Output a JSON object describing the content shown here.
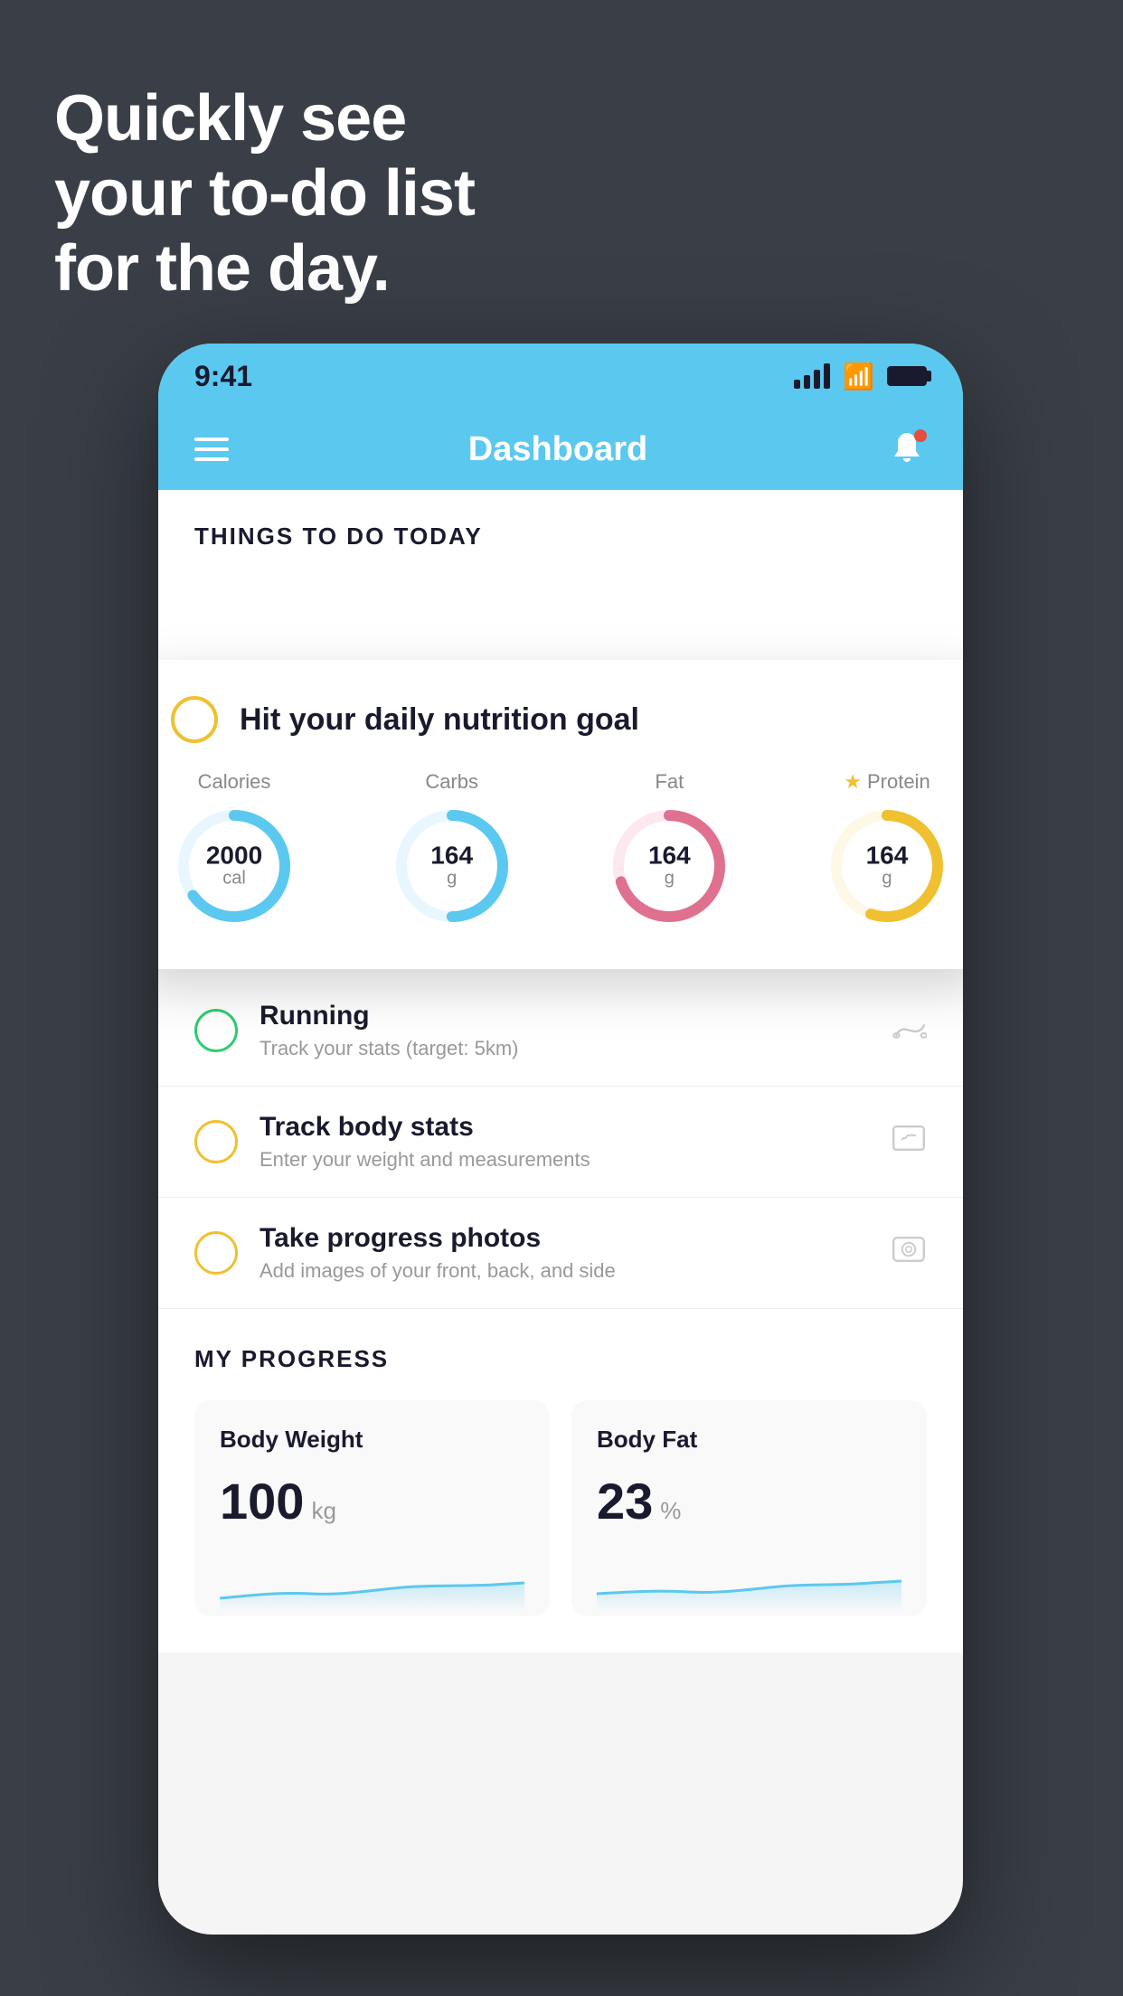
{
  "headline": {
    "line1": "Quickly see",
    "line2": "your to-do list",
    "line3": "for the day."
  },
  "statusBar": {
    "time": "9:41"
  },
  "appHeader": {
    "title": "Dashboard"
  },
  "thingsToDo": {
    "sectionTitle": "THINGS TO DO TODAY"
  },
  "nutritionCard": {
    "checkLabel": "Hit your daily nutrition goal",
    "items": [
      {
        "label": "Calories",
        "value": "2000",
        "unit": "cal",
        "color": "#5bc8f0",
        "percent": 65,
        "starred": false
      },
      {
        "label": "Carbs",
        "value": "164",
        "unit": "g",
        "color": "#5bc8f0",
        "percent": 50,
        "starred": false
      },
      {
        "label": "Fat",
        "value": "164",
        "unit": "g",
        "color": "#e07090",
        "percent": 70,
        "starred": false
      },
      {
        "label": "Protein",
        "value": "164",
        "unit": "g",
        "color": "#f0c030",
        "percent": 55,
        "starred": true
      }
    ]
  },
  "todoItems": [
    {
      "name": "Running",
      "sub": "Track your stats (target: 5km)",
      "circleColor": "green",
      "icon": "👟"
    },
    {
      "name": "Track body stats",
      "sub": "Enter your weight and measurements",
      "circleColor": "yellow",
      "icon": "⬜"
    },
    {
      "name": "Take progress photos",
      "sub": "Add images of your front, back, and side",
      "circleColor": "yellow",
      "icon": "🖼"
    }
  ],
  "progressSection": {
    "title": "MY PROGRESS",
    "cards": [
      {
        "title": "Body Weight",
        "value": "100",
        "unit": "kg"
      },
      {
        "title": "Body Fat",
        "value": "23",
        "unit": "%"
      }
    ]
  }
}
